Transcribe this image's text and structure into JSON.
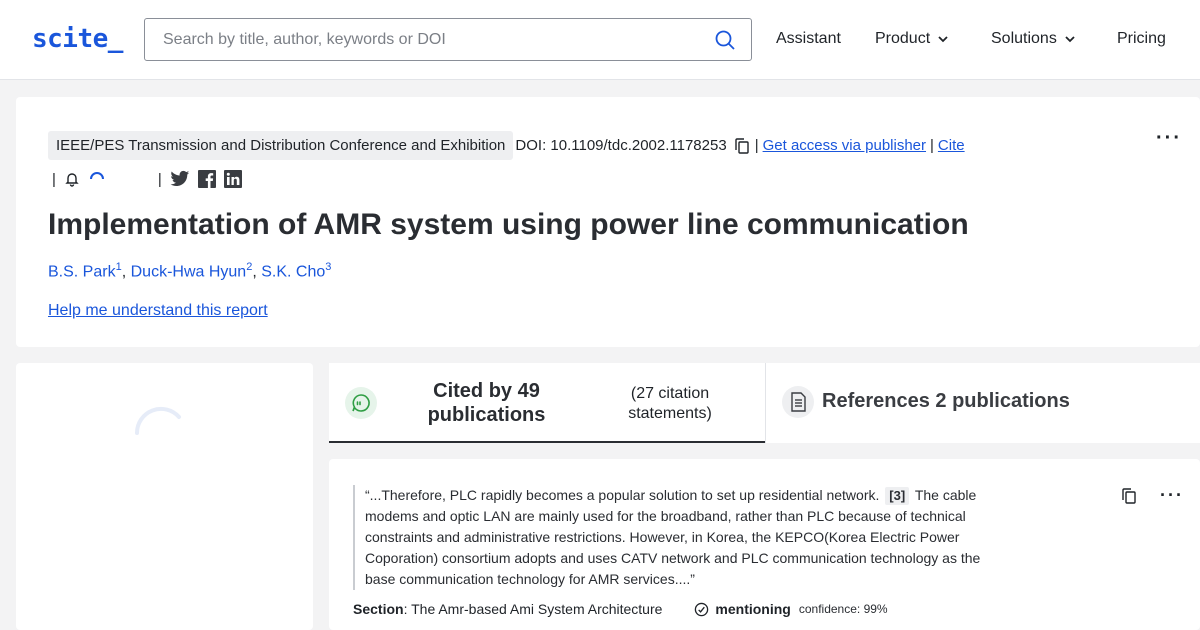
{
  "header": {
    "logo": "scite_",
    "search_placeholder": "Search by title, author, keywords or DOI",
    "nav": [
      {
        "label": "Assistant"
      },
      {
        "label": "Product"
      },
      {
        "label": "Solutions"
      },
      {
        "label": "Pricing"
      }
    ]
  },
  "paper": {
    "venue": "IEEE/PES Transmission and Distribution Conference and Exhibition",
    "doi": "DOI: 10.1109/tdc.2002.1178253",
    "sep": "|",
    "access_link": "Get access via publisher",
    "cite_link": "Cite",
    "title": "Implementation of AMR system using power line communication",
    "authors": [
      {
        "name": "B.S. Park",
        "sup": "1"
      },
      {
        "name": "Duck-Hwa Hyun",
        "sup": "2"
      },
      {
        "name": "S.K. Cho",
        "sup": "3"
      }
    ],
    "comma": ",",
    "help_link": "Help me understand this report",
    "more": "···"
  },
  "tabs": {
    "cited_title": "Cited by 49 publications",
    "cited_statements": "(27 citation statements)",
    "references_title": "References 2 publications"
  },
  "citation": {
    "quote_before": "“...Therefore, PLC rapidly becomes a popular solution to set up residential network.",
    "ref_label": "[3]",
    "quote_after": "The cable modems and optic LAN are mainly used for the broadband, rather than PLC because of technical constraints and administrative restrictions. However, in Korea, the KEPCO(Korea Electric Power Coporation) consortium adopts and uses CATV network and PLC communication technology as the base communication technology for AMR services....”",
    "section_label": "Section",
    "section_value": ": The Amr-based Ami System Architecture",
    "mention": "mentioning",
    "confidence": "confidence: 99%",
    "more": "···"
  },
  "colors": {
    "accent": "#1a56db",
    "cited_green": "#2f9e44"
  }
}
